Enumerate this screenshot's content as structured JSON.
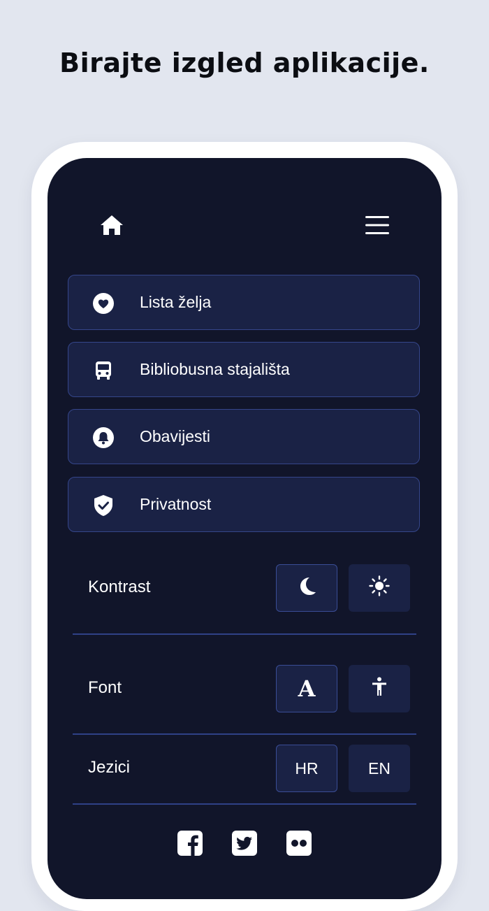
{
  "headline": "Birajte izgled aplikacije.",
  "topbar": {
    "home_icon": "home-icon",
    "menu_icon": "hamburger-menu-icon"
  },
  "menu": {
    "items": [
      {
        "label": "Lista želja",
        "icon": "heart-icon"
      },
      {
        "label": "Bibliobusna stajališta",
        "icon": "bus-icon"
      },
      {
        "label": "Obavijesti",
        "icon": "bell-icon"
      },
      {
        "label": "Privatnost",
        "icon": "shield-check-icon"
      }
    ]
  },
  "settings": {
    "contrast": {
      "label": "Kontrast",
      "options": [
        "moon-icon",
        "sun-icon"
      ],
      "selected": "moon-icon"
    },
    "font": {
      "label": "Font",
      "options": [
        {
          "text": "A",
          "icon": "font-serif-icon"
        },
        {
          "icon": "accessibility-icon"
        }
      ],
      "selected": "font-serif-icon"
    },
    "languages": {
      "label": "Jezici",
      "options": [
        "HR",
        "EN"
      ],
      "selected": "HR"
    }
  },
  "social": [
    "facebook-icon",
    "twitter-icon",
    "flickr-icon"
  ],
  "colors": {
    "background": "#e2e6ef",
    "screen": "#11152a",
    "item": "#1a2245",
    "border": "#35468a",
    "text": "#ffffff"
  }
}
